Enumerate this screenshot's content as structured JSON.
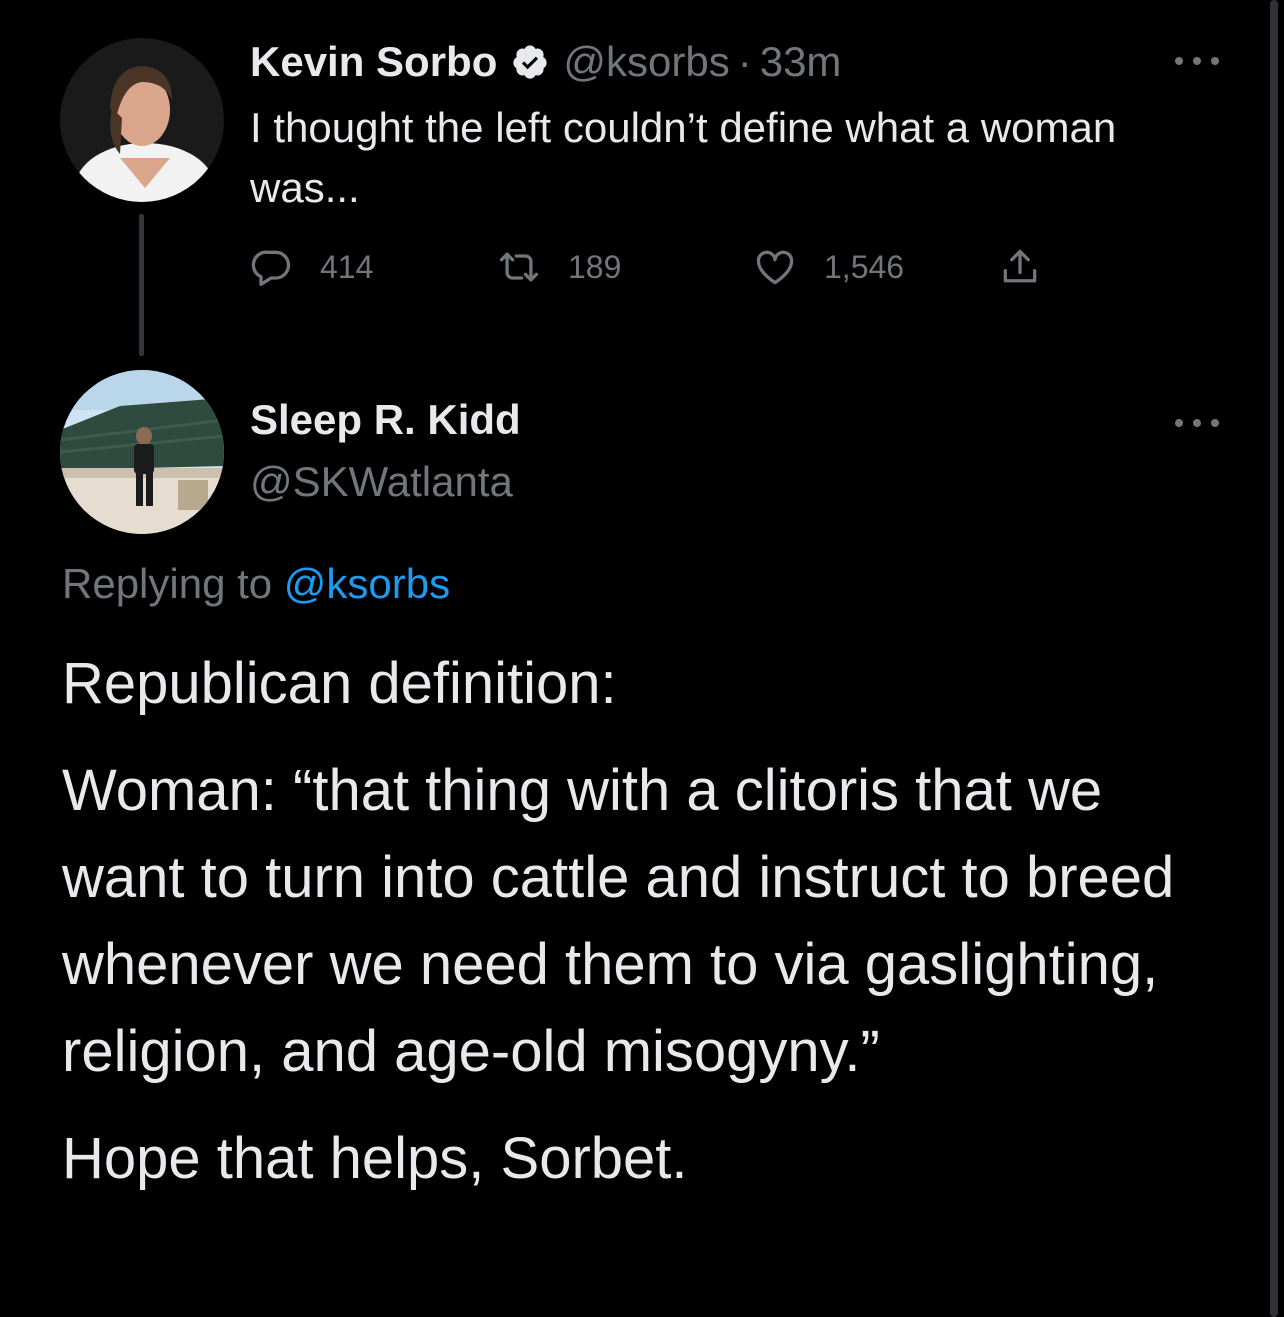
{
  "tweet1": {
    "name": "Kevin Sorbo",
    "handle": "@ksorbs",
    "separator": "·",
    "time": "33m",
    "text": "I thought the left couldn’t define what a woman was...",
    "replies": "414",
    "retweets": "189",
    "likes": "1,546"
  },
  "tweet2": {
    "name": "Sleep R. Kidd",
    "handle": "@SKWatlanta",
    "replying_prefix": "Replying to",
    "replying_to": "@ksorbs",
    "paragraphs": [
      "Republican definition:",
      "Woman: “that thing with a clitoris that we want to turn into cattle and instruct to breed whenever we need them to via gaslighting, religion, and age-old misogyny.”",
      "Hope that helps, Sorbet."
    ]
  },
  "colors": {
    "background": "#000000",
    "primary_text": "#e7e9ea",
    "secondary_text": "#71767b",
    "link": "#1d9bf0",
    "thread_line": "#333639"
  },
  "icons": {
    "more": "more-horizontal-icon",
    "verified": "verified-badge-icon",
    "reply": "reply-icon",
    "retweet": "retweet-icon",
    "like": "heart-icon",
    "share": "share-icon"
  }
}
